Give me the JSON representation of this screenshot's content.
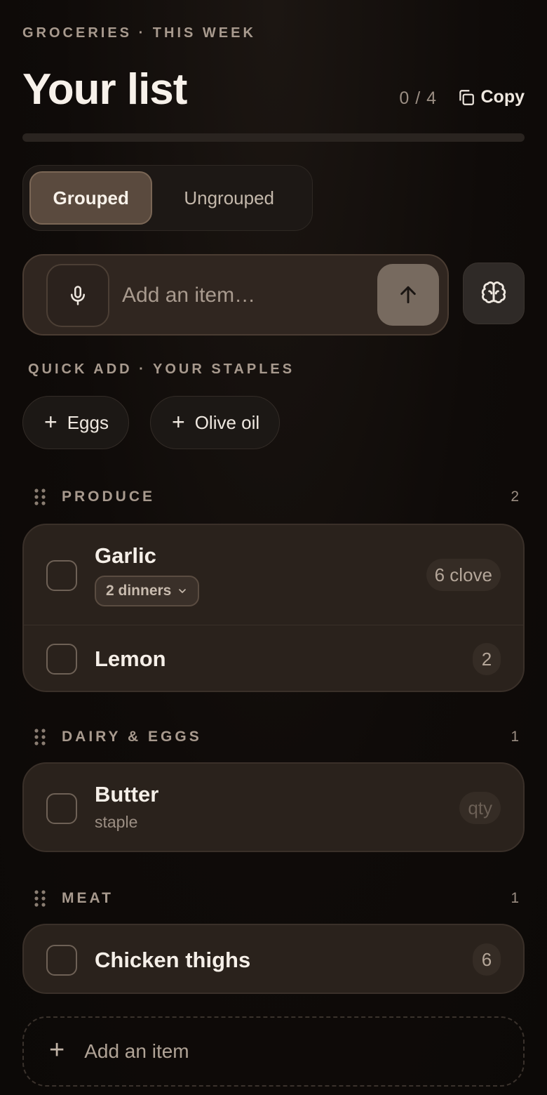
{
  "header": {
    "eyebrow": "GROCERIES · THIS WEEK",
    "title": "Your list",
    "counter": "0 / 4",
    "copy_label": "Copy",
    "progress_fraction": 0
  },
  "view_toggle": {
    "options": [
      "Grouped",
      "Ungrouped"
    ],
    "selected": "Grouped"
  },
  "add_input": {
    "placeholder": "Add an item…",
    "value": ""
  },
  "quick_add": {
    "label": "QUICK ADD · YOUR STAPLES",
    "items": [
      "Eggs",
      "Olive oil"
    ]
  },
  "sections": [
    {
      "title": "PRODUCE",
      "count": "2",
      "items": [
        {
          "name": "Garlic",
          "tag": "2 dinners",
          "qty": "6 clove"
        },
        {
          "name": "Lemon",
          "qty": "2"
        }
      ]
    },
    {
      "title": "DAIRY & EGGS",
      "count": "1",
      "items": [
        {
          "name": "Butter",
          "note": "staple",
          "qty": "qty"
        }
      ]
    },
    {
      "title": "MEAT",
      "count": "1",
      "items": [
        {
          "name": "Chicken thighs",
          "qty": "6"
        }
      ]
    }
  ],
  "add_row_label": "Add an item",
  "icons": {
    "copy": "copy-icon",
    "mic": "microphone-icon",
    "send": "arrow-up-icon",
    "brain": "brain-icon",
    "grip": "drag-handle-icon",
    "chevron": "chevron-down-icon",
    "plus": "plus-icon"
  },
  "colors": {
    "background": "#0f0b09",
    "card": "#2a221c",
    "accent": "#5a4a3e",
    "muted_text": "#a89a8e"
  }
}
